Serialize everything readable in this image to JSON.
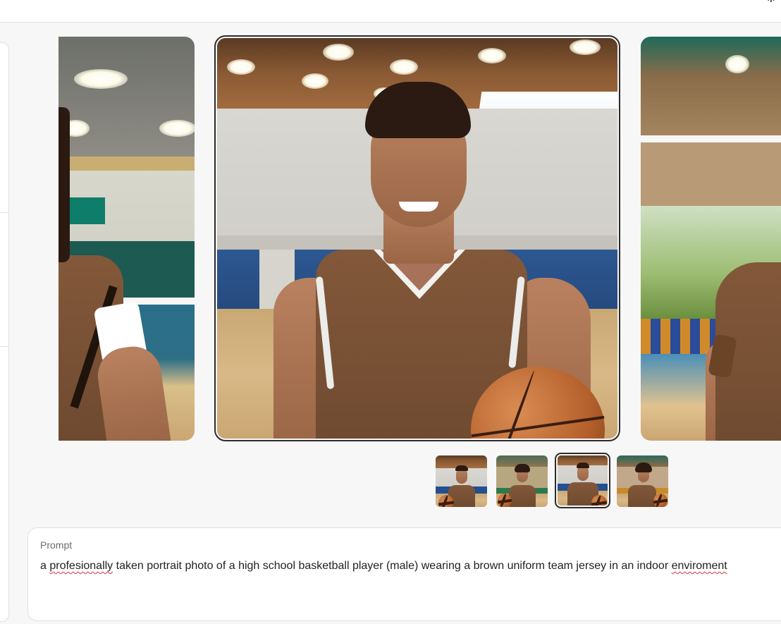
{
  "prompt": {
    "label": "Prompt",
    "text_parts": [
      {
        "text": "a ",
        "misspelled": false
      },
      {
        "text": "profesionally",
        "misspelled": true
      },
      {
        "text": " taken portrait photo of a high school basketball player (male) wearing a brown uniform team jersey in an indoor ",
        "misspelled": false
      },
      {
        "text": "enviroment",
        "misspelled": true
      }
    ]
  },
  "carousel": {
    "selected_index": 2,
    "thumbnail_count": 4
  },
  "colors": {
    "selection_border": "#2c2c2c",
    "spellcheck_underline": "#d7373f",
    "jersey_brown": "#7a5234",
    "court_blue": "#24508f"
  },
  "icons": {
    "corner": "settings-icon"
  }
}
